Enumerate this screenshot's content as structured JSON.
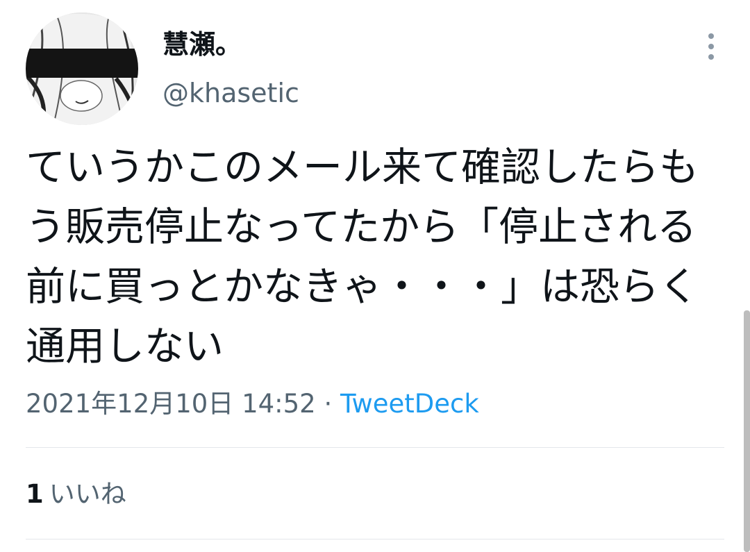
{
  "tweet": {
    "author": {
      "display_name": "慧瀬。",
      "handle": "@khasetic",
      "avatar_icon": "avatar-image"
    },
    "text": "ていうかこのメール来て確認したらもう販売停止なってたから「停止される前に買っとかなきゃ・・・」は恐らく通用しない",
    "timestamp": "2021年12月10日 14:52",
    "separator": "·",
    "source": "TweetDeck",
    "likes": {
      "count": "1",
      "label": "いいね"
    }
  },
  "icons": {
    "more": "more-vertical-icon"
  },
  "colors": {
    "text_primary": "#0f1419",
    "text_secondary": "#536471",
    "link": "#1d9bf0",
    "divider": "#e4e7ea"
  }
}
